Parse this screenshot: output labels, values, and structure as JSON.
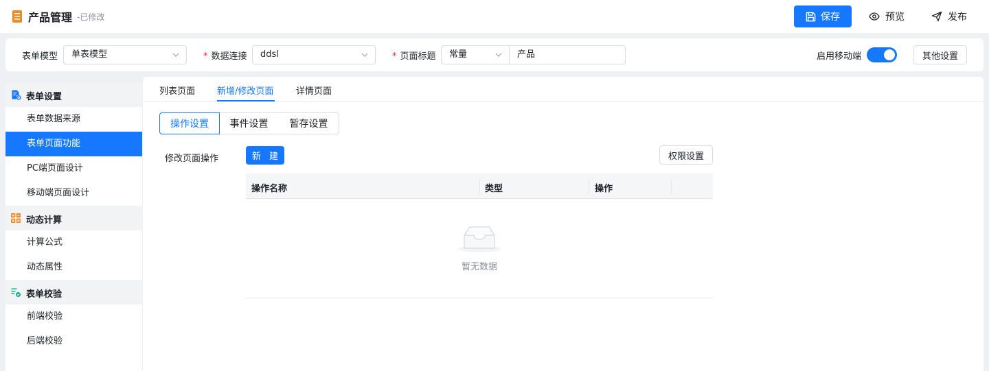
{
  "header": {
    "title": "产品管理",
    "status": "-已修改",
    "save_label": "保存",
    "preview_label": "预览",
    "publish_label": "发布"
  },
  "config": {
    "form_model_label": "表单模型",
    "form_model_value": "单表模型",
    "data_conn_label": "数据连接",
    "data_conn_value": "ddsl",
    "page_title_label": "页面标题",
    "page_title_type": "常量",
    "page_title_value": "产品",
    "mobile_label": "启用移动端",
    "mobile_enabled": true,
    "other_settings_label": "其他设置"
  },
  "sidebar": {
    "groups": [
      {
        "label": "表单设置",
        "icon": "form-settings-icon",
        "items": [
          "表单数据来源",
          "表单页面功能",
          "PC端页面设计",
          "移动端页面设计"
        ]
      },
      {
        "label": "动态计算",
        "icon": "calculator-icon",
        "items": [
          "计算公式",
          "动态属性"
        ]
      },
      {
        "label": "表单校验",
        "icon": "checklist-icon",
        "items": [
          "前端校验",
          "后端校验"
        ]
      }
    ],
    "active_item": "表单页面功能"
  },
  "tabs": [
    "列表页面",
    "新增/修改页面",
    "详情页面"
  ],
  "active_tab": "新增/修改页面",
  "segments": [
    "操作设置",
    "事件设置",
    "暂存设置"
  ],
  "active_segment": "操作设置",
  "operations": {
    "label": "修改页面操作",
    "new_label": "新 建",
    "permission_label": "权限设置",
    "columns": [
      "操作名称",
      "类型",
      "操作"
    ],
    "rows": [],
    "empty_text": "暂无数据"
  },
  "colors": {
    "primary": "#1677ff",
    "required": "#f5222d",
    "app_icon": "#f08a24"
  }
}
